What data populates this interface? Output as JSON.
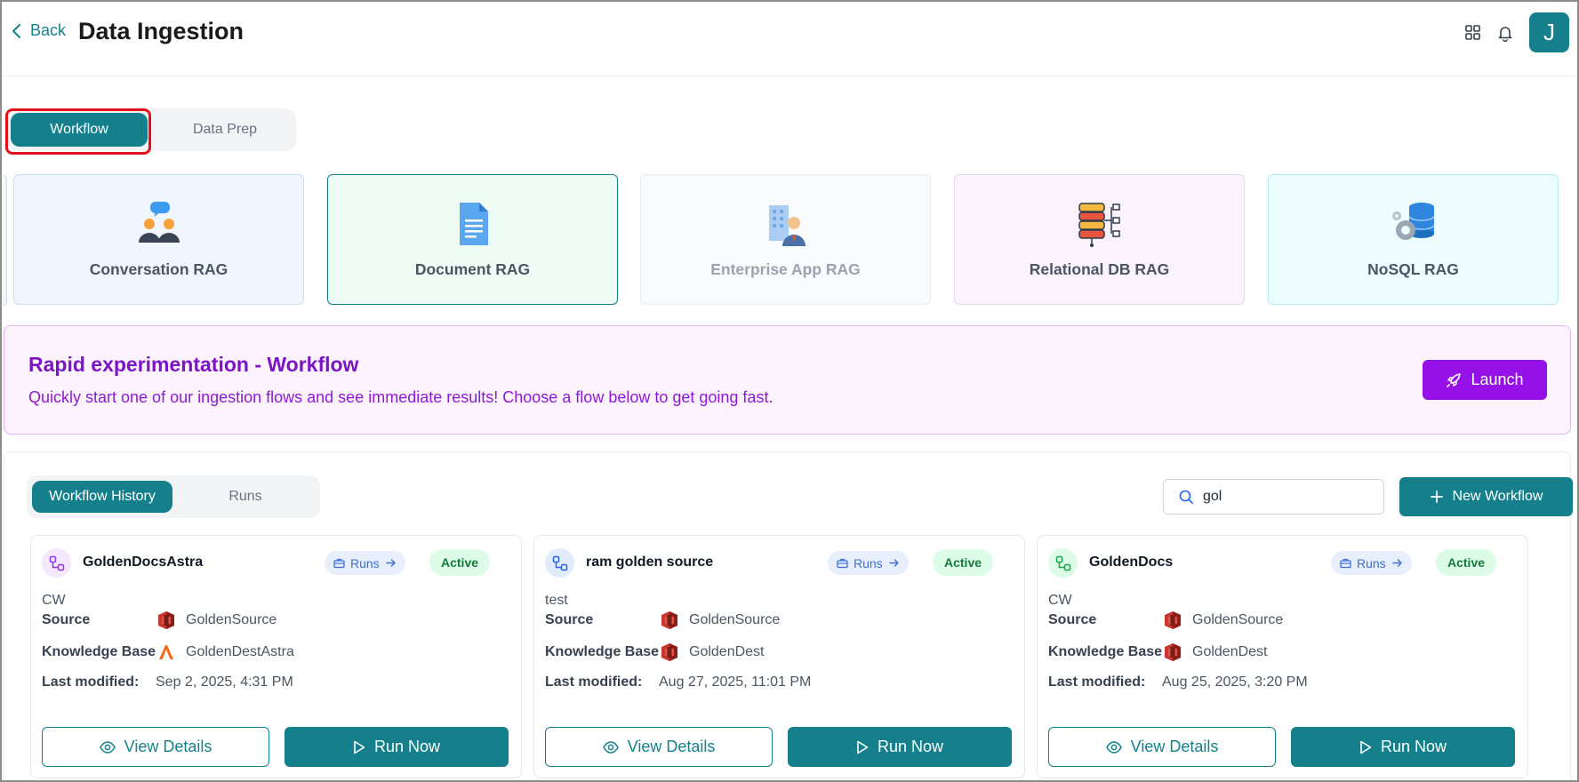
{
  "header": {
    "back_label": "Back",
    "title": "Data Ingestion",
    "avatar_initial": "J"
  },
  "top_tabs": {
    "active": "Workflow",
    "inactive": "Data Prep"
  },
  "rag_types": [
    {
      "label": "Conversation RAG",
      "icon": "people-chat-icon",
      "bg": "#eff6ff",
      "border": "#c9ddf5",
      "disabled": false
    },
    {
      "label": "Document RAG",
      "icon": "document-icon",
      "bg": "#effbf5",
      "border": "#15808b",
      "disabled": false
    },
    {
      "label": "Enterprise App RAG",
      "icon": "enterprise-building-icon",
      "bg": "#f9fafb",
      "border": "#e7eaee",
      "disabled": true
    },
    {
      "label": "Relational DB RAG",
      "icon": "database-tree-icon",
      "bg": "#faf3fd",
      "border": "#ead6f6",
      "disabled": false
    },
    {
      "label": "NoSQL RAG",
      "icon": "database-gear-icon",
      "bg": "#edfcfd",
      "border": "#b3eef3",
      "disabled": false
    }
  ],
  "banner": {
    "title": "Rapid experimentation - Workflow",
    "subtitle": "Quickly start one of our ingestion flows and see immediate results! Choose a flow below to get going fast.",
    "launch_label": "Launch"
  },
  "history_tabs": {
    "active": "Workflow History",
    "inactive": "Runs"
  },
  "search": {
    "value": "gol",
    "placeholder": ""
  },
  "new_workflow_label": "New Workflow",
  "labels": {
    "source": "Source",
    "knowledge_base": "Knowledge Base",
    "last_modified": "Last modified:",
    "runs": "Runs",
    "view_details": "View Details",
    "run_now": "Run Now"
  },
  "workflows": [
    {
      "name": "GoldenDocsAstra",
      "status": "Active",
      "description": "CW",
      "source": "GoldenSource",
      "source_icon": "aws-s3-icon",
      "knowledge_base": "GoldenDestAstra",
      "kb_icon": "astra-db-icon",
      "last_modified": "Sep 2, 2025, 4:31 PM",
      "icon_color": "#9333ea",
      "icon_bg": "#f3e8ff"
    },
    {
      "name": "ram golden source",
      "status": "Active",
      "description": "test",
      "source": "GoldenSource",
      "source_icon": "aws-s3-icon",
      "knowledge_base": "GoldenDest",
      "kb_icon": "aws-s3-icon",
      "last_modified": "Aug 27, 2025, 11:01 PM",
      "icon_color": "#2563eb",
      "icon_bg": "#e0ecfd"
    },
    {
      "name": "GoldenDocs",
      "status": "Active",
      "description": "CW",
      "source": "GoldenSource",
      "source_icon": "aws-s3-icon",
      "knowledge_base": "GoldenDest",
      "kb_icon": "aws-s3-icon",
      "last_modified": "Aug 25, 2025, 3:20 PM",
      "icon_color": "#16a34a",
      "icon_bg": "#dcfce7"
    }
  ]
}
